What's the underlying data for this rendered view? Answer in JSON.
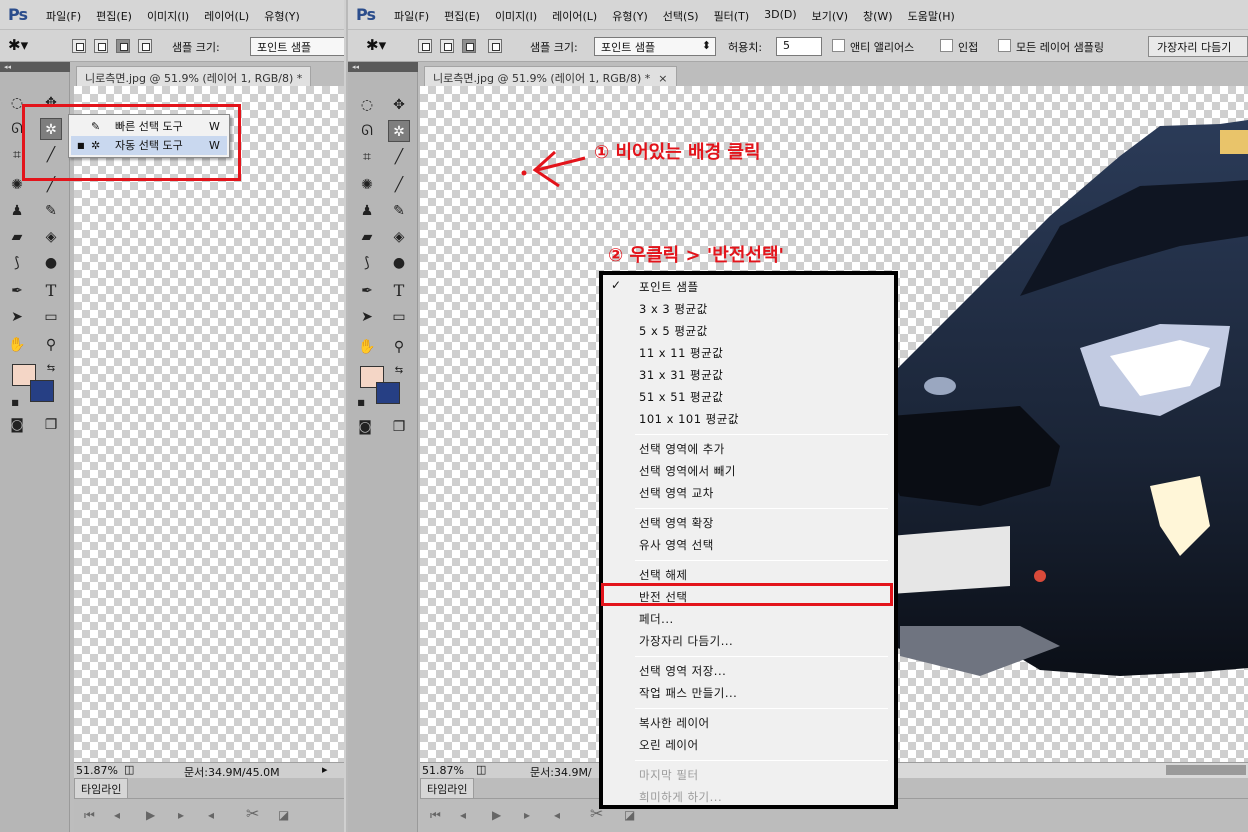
{
  "app": {
    "logo": "Ps"
  },
  "menu_left": [
    "파일(F)",
    "편집(E)",
    "이미지(I)",
    "레이어(L)",
    "유형(Y)"
  ],
  "menu_right": [
    "파일(F)",
    "편집(E)",
    "이미지(I)",
    "레이어(L)",
    "유형(Y)",
    "선택(S)",
    "필터(T)",
    "3D(D)",
    "보기(V)",
    "창(W)",
    "도움말(H)"
  ],
  "options": {
    "sample_size_label": "샘플 크기:",
    "sample_size_value": "포인트 샘플",
    "tolerance_label": "허용치:",
    "tolerance_value": "5",
    "antialias_label": "앤티 앨리어스",
    "contiguous_label": "인접",
    "all_layers_label": "모든 레이어 샘플링",
    "refine_edge_button": "가장자리 다듬기"
  },
  "document": {
    "tab_title": "니로측면.jpg @ 51.9% (레이어 1, RGB/8) *",
    "close": "×",
    "zoom": "51.87%",
    "doc_size": "문서:34.9M/45.0M",
    "doc_size_right": "문서:34.9M/"
  },
  "timeline": {
    "label": "타임라인"
  },
  "tool_flyout": {
    "items": [
      {
        "label": "빠른 선택 도구",
        "shortcut": "W"
      },
      {
        "label": "자동 선택 도구",
        "shortcut": "W"
      }
    ]
  },
  "colors": {
    "foreground": "#f4d6c6",
    "background": "#263f84",
    "annotation": "#e3141b"
  },
  "annotations": {
    "step1": "① 비어있는 배경 클릭",
    "step2": "② 우클릭 > '반전선택'"
  },
  "context_menu": {
    "groups": [
      [
        {
          "label": "포인트 샘플",
          "checked": true
        },
        {
          "label": "3 x 3 평균값"
        },
        {
          "label": "5 x 5 평균값"
        },
        {
          "label": "11 x 11 평균값"
        },
        {
          "label": "31 x 31 평균값"
        },
        {
          "label": "51 x 51 평균값"
        },
        {
          "label": "101 x 101 평균값"
        }
      ],
      [
        {
          "label": "선택 영역에 추가"
        },
        {
          "label": "선택 영역에서 빼기"
        },
        {
          "label": "선택 영역 교차"
        }
      ],
      [
        {
          "label": "선택 영역 확장"
        },
        {
          "label": "유사 영역 선택"
        }
      ],
      [
        {
          "label": "선택 해제"
        },
        {
          "label": "반전 선택",
          "highlighted": true
        },
        {
          "label": "페더..."
        },
        {
          "label": "가장자리 다듬기..."
        }
      ],
      [
        {
          "label": "선택 영역 저장..."
        },
        {
          "label": "작업 패스 만들기..."
        }
      ],
      [
        {
          "label": "복사한 레이어"
        },
        {
          "label": "오린 레이어"
        }
      ],
      [
        {
          "label": "마지막 필터",
          "disabled": true
        },
        {
          "label": "희미하게 하기...",
          "disabled": true
        }
      ]
    ]
  }
}
